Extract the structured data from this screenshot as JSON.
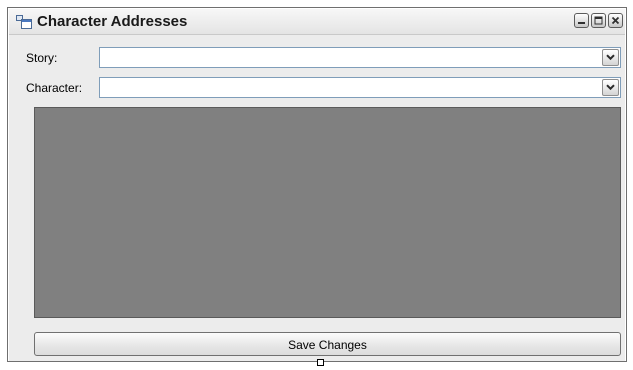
{
  "window": {
    "title": "Character Addresses",
    "icons": {
      "app": "form-window-icon",
      "minimize": "minimize-icon",
      "maximize": "maximize-icon",
      "close": "close-icon"
    }
  },
  "form": {
    "story": {
      "label": "Story:",
      "value": "",
      "dropdown_icon": "chevron-down-icon"
    },
    "character": {
      "label": "Character:",
      "value": "",
      "dropdown_icon": "chevron-down-icon"
    },
    "grid": {
      "background_color": "#808080"
    },
    "save_label": "Save Changes"
  }
}
